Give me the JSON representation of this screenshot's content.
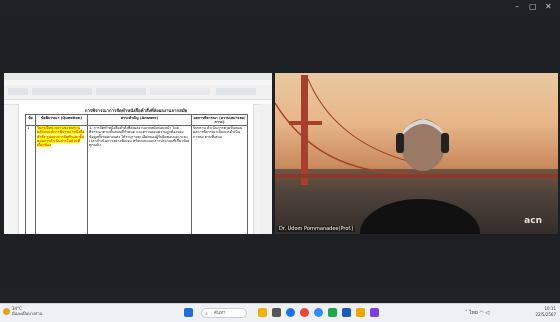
{
  "window_controls": {
    "minimize": "–",
    "restore": "▢",
    "close": "✕"
  },
  "word": {
    "doc_title": "การพิจารณาการจัดทำหนังสือคำสั่งที่ส่งผลงานจากสมัย",
    "columns": [
      "ข้อ",
      "ข้อพิจารณา (Question)",
      "สาระสำคัญ (Answer)",
      "ผลการพิจารณา (ความเหมาะสม/ภาวะ)"
    ],
    "row": {
      "no": "1",
      "question": "ในกรณีหน่วยงานขอทบทวนหลักเกณฑ์การพิจารณาหนังสือคำสั่ง รูปแบบการจัดทำและขั้นตอนการดำเนินการในส่วนที่เกี่ยวข้อง",
      "answer": "1. การจัดทำหนังสือคำสั่งที่ส่งผลงานจากสมัยก่อนหน้า โดยพิจารณาตามขั้นตอนที่กำหนด และตรวจสอบความถูกต้องของข้อมูลทั้งหมดก่อนส่ง ให้ระบุรายละเอียดของผู้รับผิดชอบและระยะเวลาดำเนินการอย่างชัดเจน พร้อมแนบเอกสารประกอบที่เกี่ยวข้องทุกฉบับ",
      "result": "รับทราบ ดำเนินการตามขั้นตอน ผลการพิจารณาเห็นควรดำเนินการต่อ ตามที่เสนอ"
    }
  },
  "video": {
    "participant_name": "Dr. Udom Pornmanadee(Prof.)",
    "logo": "acn"
  },
  "taskbar": {
    "weather": {
      "temp": "34°C",
      "desc": "มีเมฆเป็นบางส่วน"
    },
    "search_placeholder": "ค้นหา",
    "tray": {
      "lang": "ไทย",
      "time": "10:11",
      "date": "22/5/2567"
    }
  }
}
